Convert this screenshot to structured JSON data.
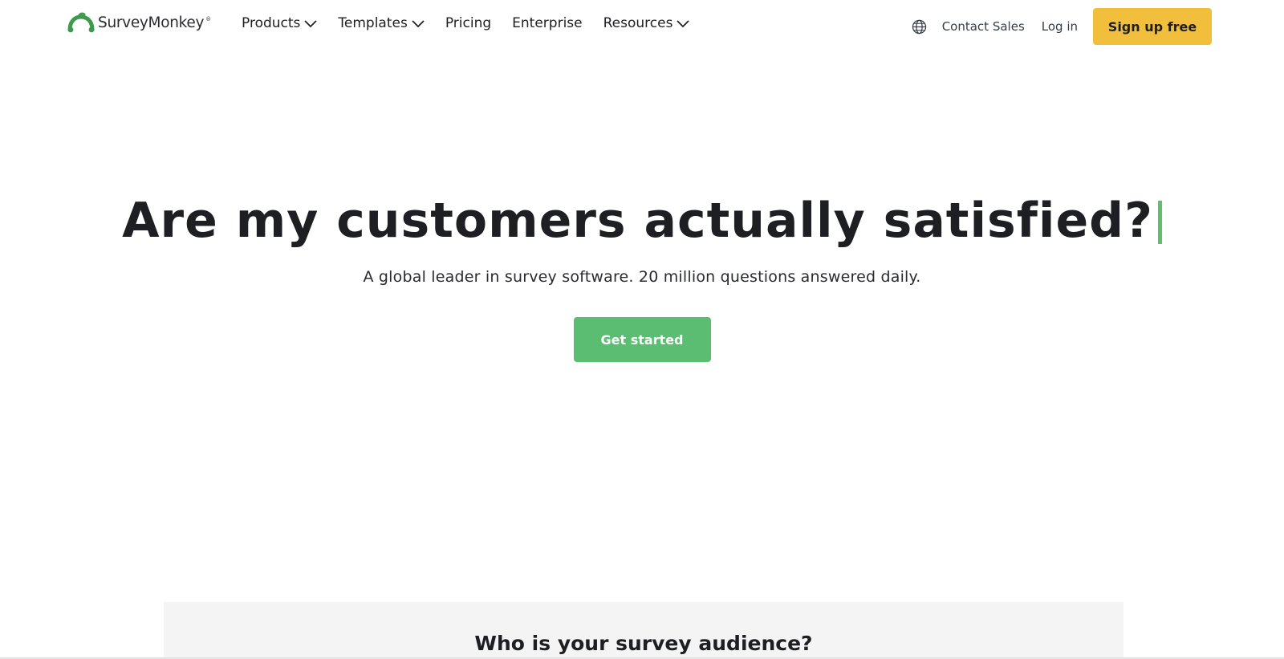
{
  "brand": {
    "name": "SurveyMonkey",
    "registered": "®",
    "logo_icon": "monkey-logo-icon",
    "logo_color": "#3d9a4a"
  },
  "nav": {
    "items": [
      {
        "label": "Products",
        "has_dropdown": true
      },
      {
        "label": "Templates",
        "has_dropdown": true
      },
      {
        "label": "Pricing",
        "has_dropdown": false
      },
      {
        "label": "Enterprise",
        "has_dropdown": false
      },
      {
        "label": "Resources",
        "has_dropdown": true
      }
    ]
  },
  "header_right": {
    "globe_icon": "globe-icon",
    "contact_label": "Contact Sales",
    "login_label": "Log in",
    "signup_label": "Sign up free",
    "signup_color": "#f2bf3d"
  },
  "hero": {
    "title": "Are my customers actually satisfied?",
    "subtitle": "A global leader in survey software. 20 million questions answered daily.",
    "cta_label": "Get started",
    "cta_color": "#5bbd72",
    "cursor_color": "#5fbf6e"
  },
  "audience": {
    "title": "Who is your survey audience?"
  }
}
